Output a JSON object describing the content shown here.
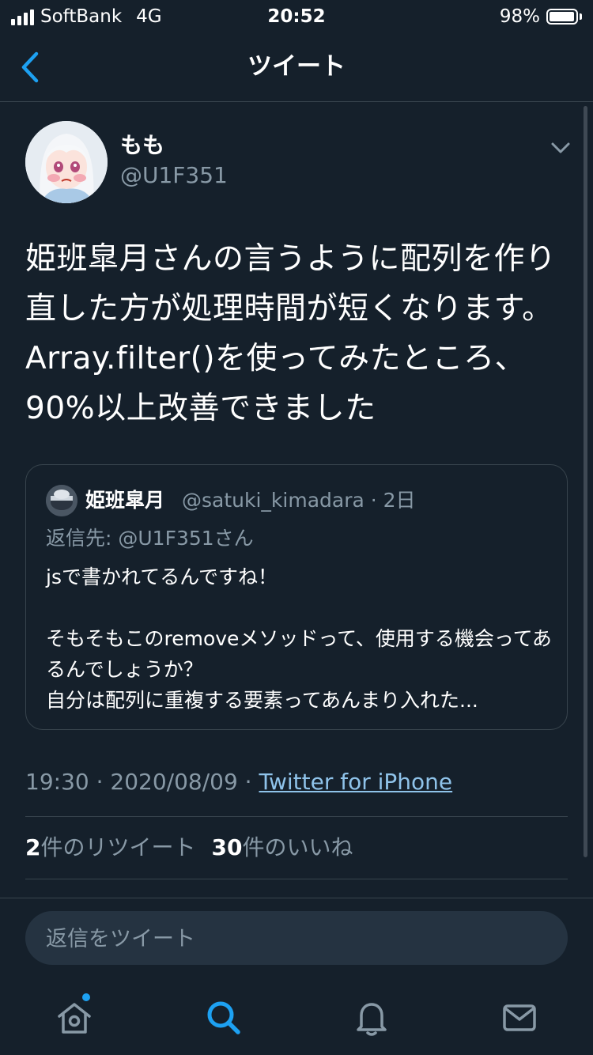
{
  "status_bar": {
    "carrier": "SoftBank",
    "network": "4G",
    "time": "20:52",
    "battery_percent": "98%",
    "battery_level": 0.98
  },
  "header": {
    "title": "ツイート",
    "back_icon": "chevron-left-icon"
  },
  "tweet": {
    "author_name": "もも",
    "author_handle": "@U1F351",
    "text": "姫班皐月さんの言うように配列を作り直した方が処理時間が短くなります。Array.filter()を使ってみたところ、90%以上改善できました",
    "timestamp": "19:30 · 2020/08/09 · ",
    "source": "Twitter for iPhone",
    "retweet_count": "2",
    "retweet_label": "件のリツイート",
    "like_count": "30",
    "like_label": "件のいいね"
  },
  "quote": {
    "author_name": "姫班皐月",
    "author_handle": "@satuki_kimadara · 2日",
    "reply_to": "返信先: @U1F351さん",
    "body_line1": "jsで書かれてるんですね！",
    "body_line2": "そもそもこのremoveメソッドって、使用する機会ってあるんでしょうか？",
    "body_line3": "自分は配列に重複する要素ってあんまり入れた..."
  },
  "reply": {
    "placeholder": "返信をツイート"
  },
  "tab_bar": {
    "items": [
      "home-icon",
      "search-icon",
      "notifications-icon",
      "messages-icon"
    ],
    "active": "search-icon"
  },
  "colors": {
    "background": "#15202b",
    "accent": "#1da1f2",
    "secondary_text": "#8899a6",
    "divider": "#38444d"
  }
}
